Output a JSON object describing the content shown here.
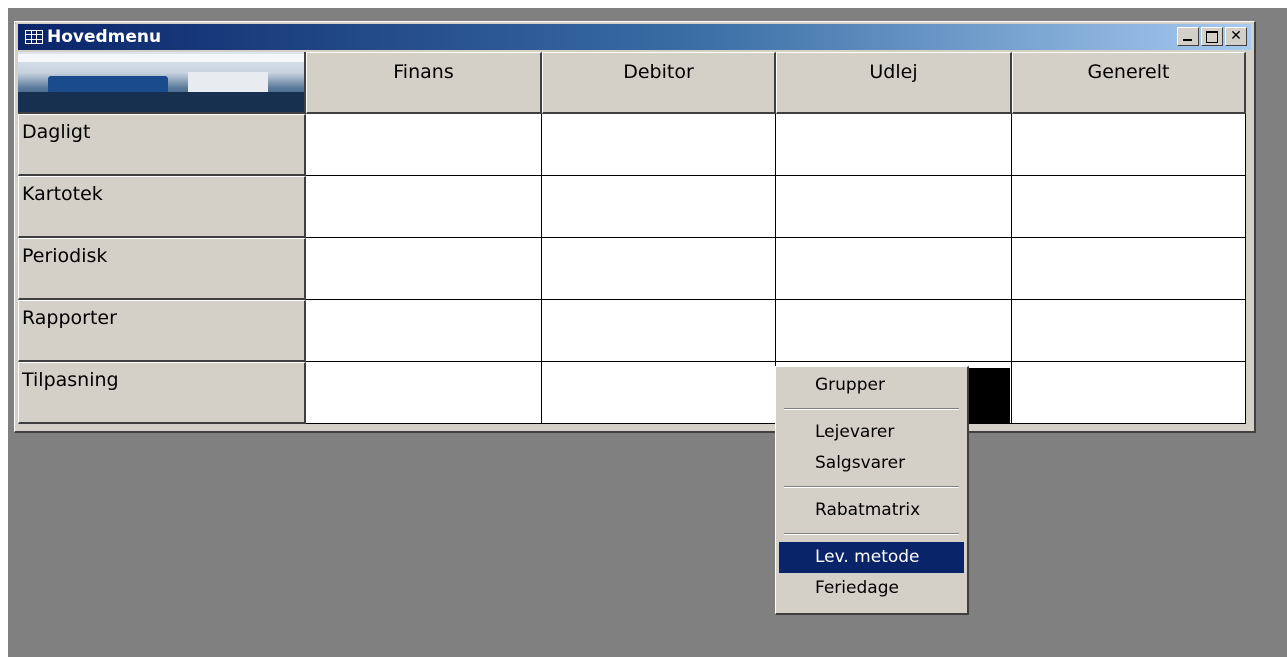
{
  "window": {
    "title": "Hovedmenu"
  },
  "columns": [
    "Finans",
    "Debitor",
    "Udlej",
    "Generelt"
  ],
  "rows": [
    "Dagligt",
    "Kartotek",
    "Periodisk",
    "Rapporter",
    "Tilpasning"
  ],
  "context_menu": {
    "groups": [
      [
        {
          "label": "Grupper",
          "selected": false
        }
      ],
      [
        {
          "label": "Lejevarer",
          "selected": false
        },
        {
          "label": "Salgsvarer",
          "selected": false
        }
      ],
      [
        {
          "label": "Rabatmatrix",
          "selected": false
        }
      ],
      [
        {
          "label": "Lev. metode",
          "selected": true
        },
        {
          "label": "Feriedage",
          "selected": false
        }
      ]
    ]
  },
  "colors": {
    "face": "#d4d0c8",
    "desktop": "#808080",
    "selection": "#0a246a",
    "title_start": "#0a246a"
  }
}
